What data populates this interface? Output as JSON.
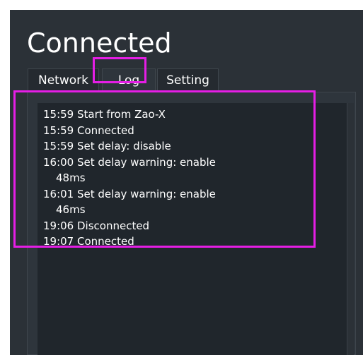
{
  "window": {
    "title": "Connected"
  },
  "tabs": [
    {
      "label": "Network",
      "active": false
    },
    {
      "label": "Log",
      "active": true
    },
    {
      "label": "Setting",
      "active": false
    }
  ],
  "log": {
    "lines": [
      "15:59 Start from Zao-X",
      "15:59 Connected",
      "15:59 Set delay: disable",
      "16:00 Set delay warning: enable",
      "48ms",
      "16:01 Set delay warning: enable",
      "46ms",
      "19:06 Disconnected",
      "19:07 Connected"
    ]
  },
  "colors": {
    "background": "#2b3137",
    "log_background": "#20262c",
    "text": "#ffffff",
    "highlight": "#e51ee5"
  }
}
